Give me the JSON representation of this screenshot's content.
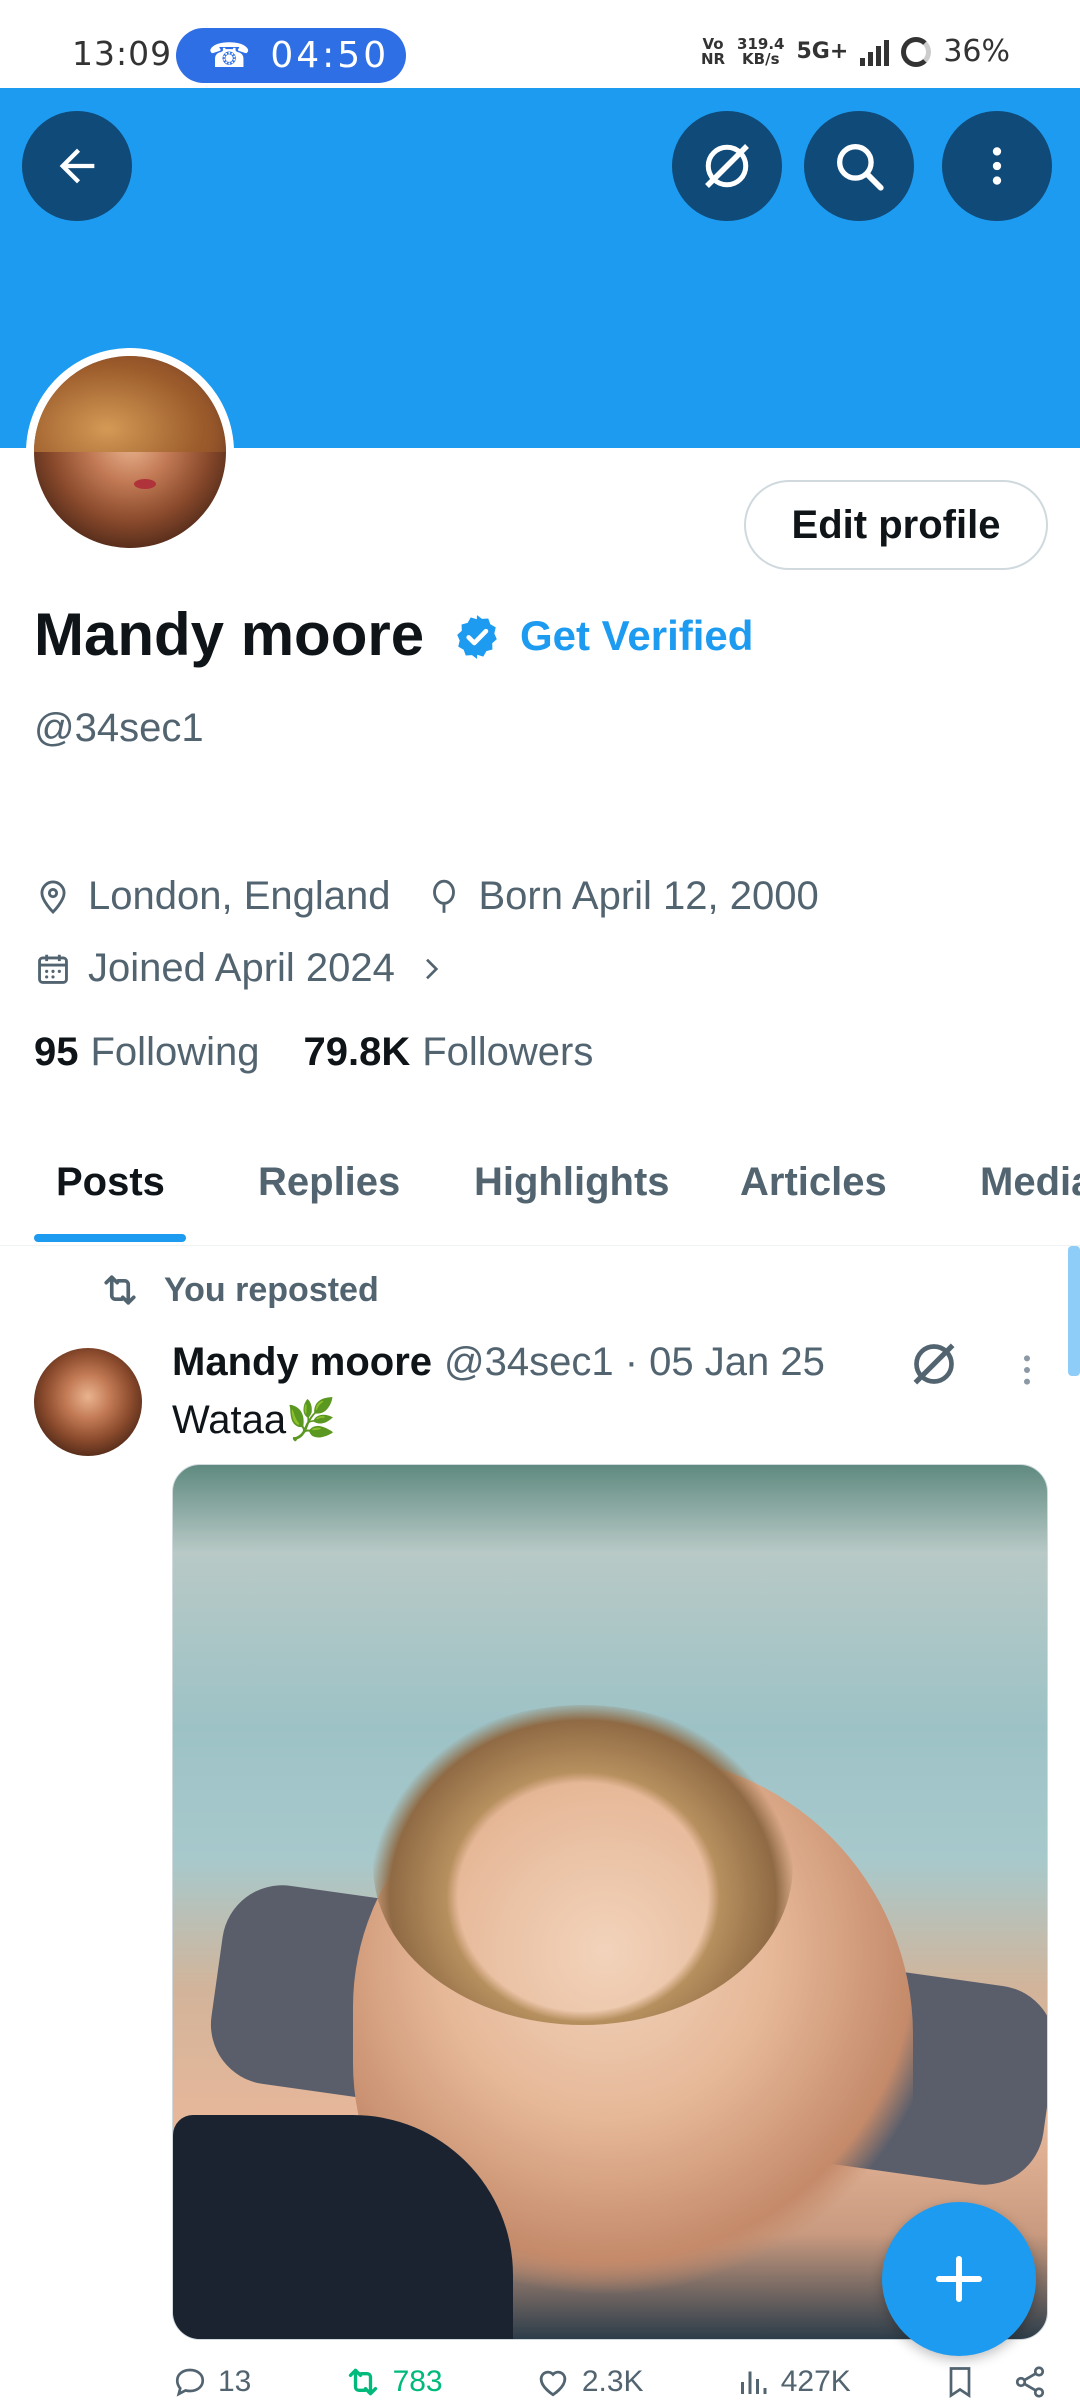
{
  "status_bar": {
    "time": "13:09",
    "call_timer": "04:50",
    "volte": "Vo\nNR",
    "speed": "319.4\nKB/s",
    "network": "5G+",
    "battery": "36%"
  },
  "colors": {
    "accent": "#1d9bf0",
    "banner": "#1d9bf0",
    "banner_button": "#0f4a78",
    "text_primary": "#0f1419",
    "text_secondary": "#536471",
    "repost_green": "#00ba7c"
  },
  "header": {
    "icons": [
      "back-arrow-icon",
      "grok-icon",
      "search-icon",
      "more-vertical-icon"
    ]
  },
  "profile": {
    "edit_label": "Edit profile",
    "name": "Mandy moore",
    "get_verified": "Get Verified",
    "handle": "@34sec1",
    "location": "London, England",
    "birthday": "Born April 12, 2000",
    "joined": "Joined April 2024",
    "following_count": "95",
    "following_label": "Following",
    "followers_count": "79.8K",
    "followers_label": "Followers"
  },
  "tabs": [
    "Posts",
    "Replies",
    "Highlights",
    "Articles",
    "Media"
  ],
  "post": {
    "repost_label": "You reposted",
    "author": "Mandy moore",
    "meta": "@34sec1 · 05 Jan 25",
    "text": "Wataa🌿",
    "replies": "13",
    "reposts": "783",
    "likes": "2.3K",
    "views": "427K"
  }
}
